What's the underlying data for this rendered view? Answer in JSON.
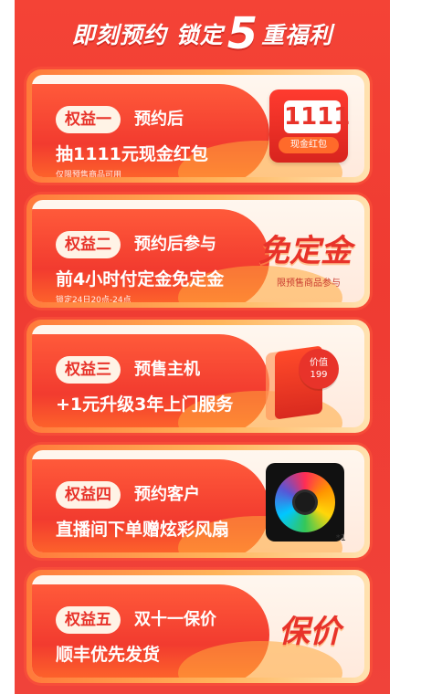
{
  "header": {
    "title_left": "即刻预约",
    "title_mid": "锁定",
    "title_num": "5",
    "title_right": "重福利"
  },
  "cards": [
    {
      "badge": "权益一",
      "subtitle": "预约后",
      "line2": "抽1111元现金红包",
      "note": "仅限预售商品可用",
      "visual": {
        "type": "redpack",
        "amount": "1111",
        "ribbon": "现金红包"
      }
    },
    {
      "badge": "权益二",
      "subtitle": "预约后参与",
      "line2": "前4小时付定金免定金",
      "note": "锁定24日20点-24点",
      "visual": {
        "type": "text",
        "big": "免定金",
        "small": "限预售商品参与"
      }
    },
    {
      "badge": "权益三",
      "subtitle": "预售主机",
      "line2": "+1元升级3年上门服务",
      "note": "",
      "visual": {
        "type": "box",
        "price_line1": "价值",
        "price_line2": "199"
      }
    },
    {
      "badge": "权益四",
      "subtitle": "预约客户",
      "line2": "直播间下单赠炫彩风扇",
      "note": "",
      "visual": {
        "type": "fan",
        "count": "*1"
      }
    },
    {
      "badge": "权益五",
      "subtitle": "双十一保价",
      "line2": "顺丰优先发货",
      "note": "",
      "visual": {
        "type": "text",
        "big": "保价",
        "small": ""
      }
    }
  ],
  "colors": {
    "panel": "#f44336",
    "accent": "#e8332a"
  }
}
